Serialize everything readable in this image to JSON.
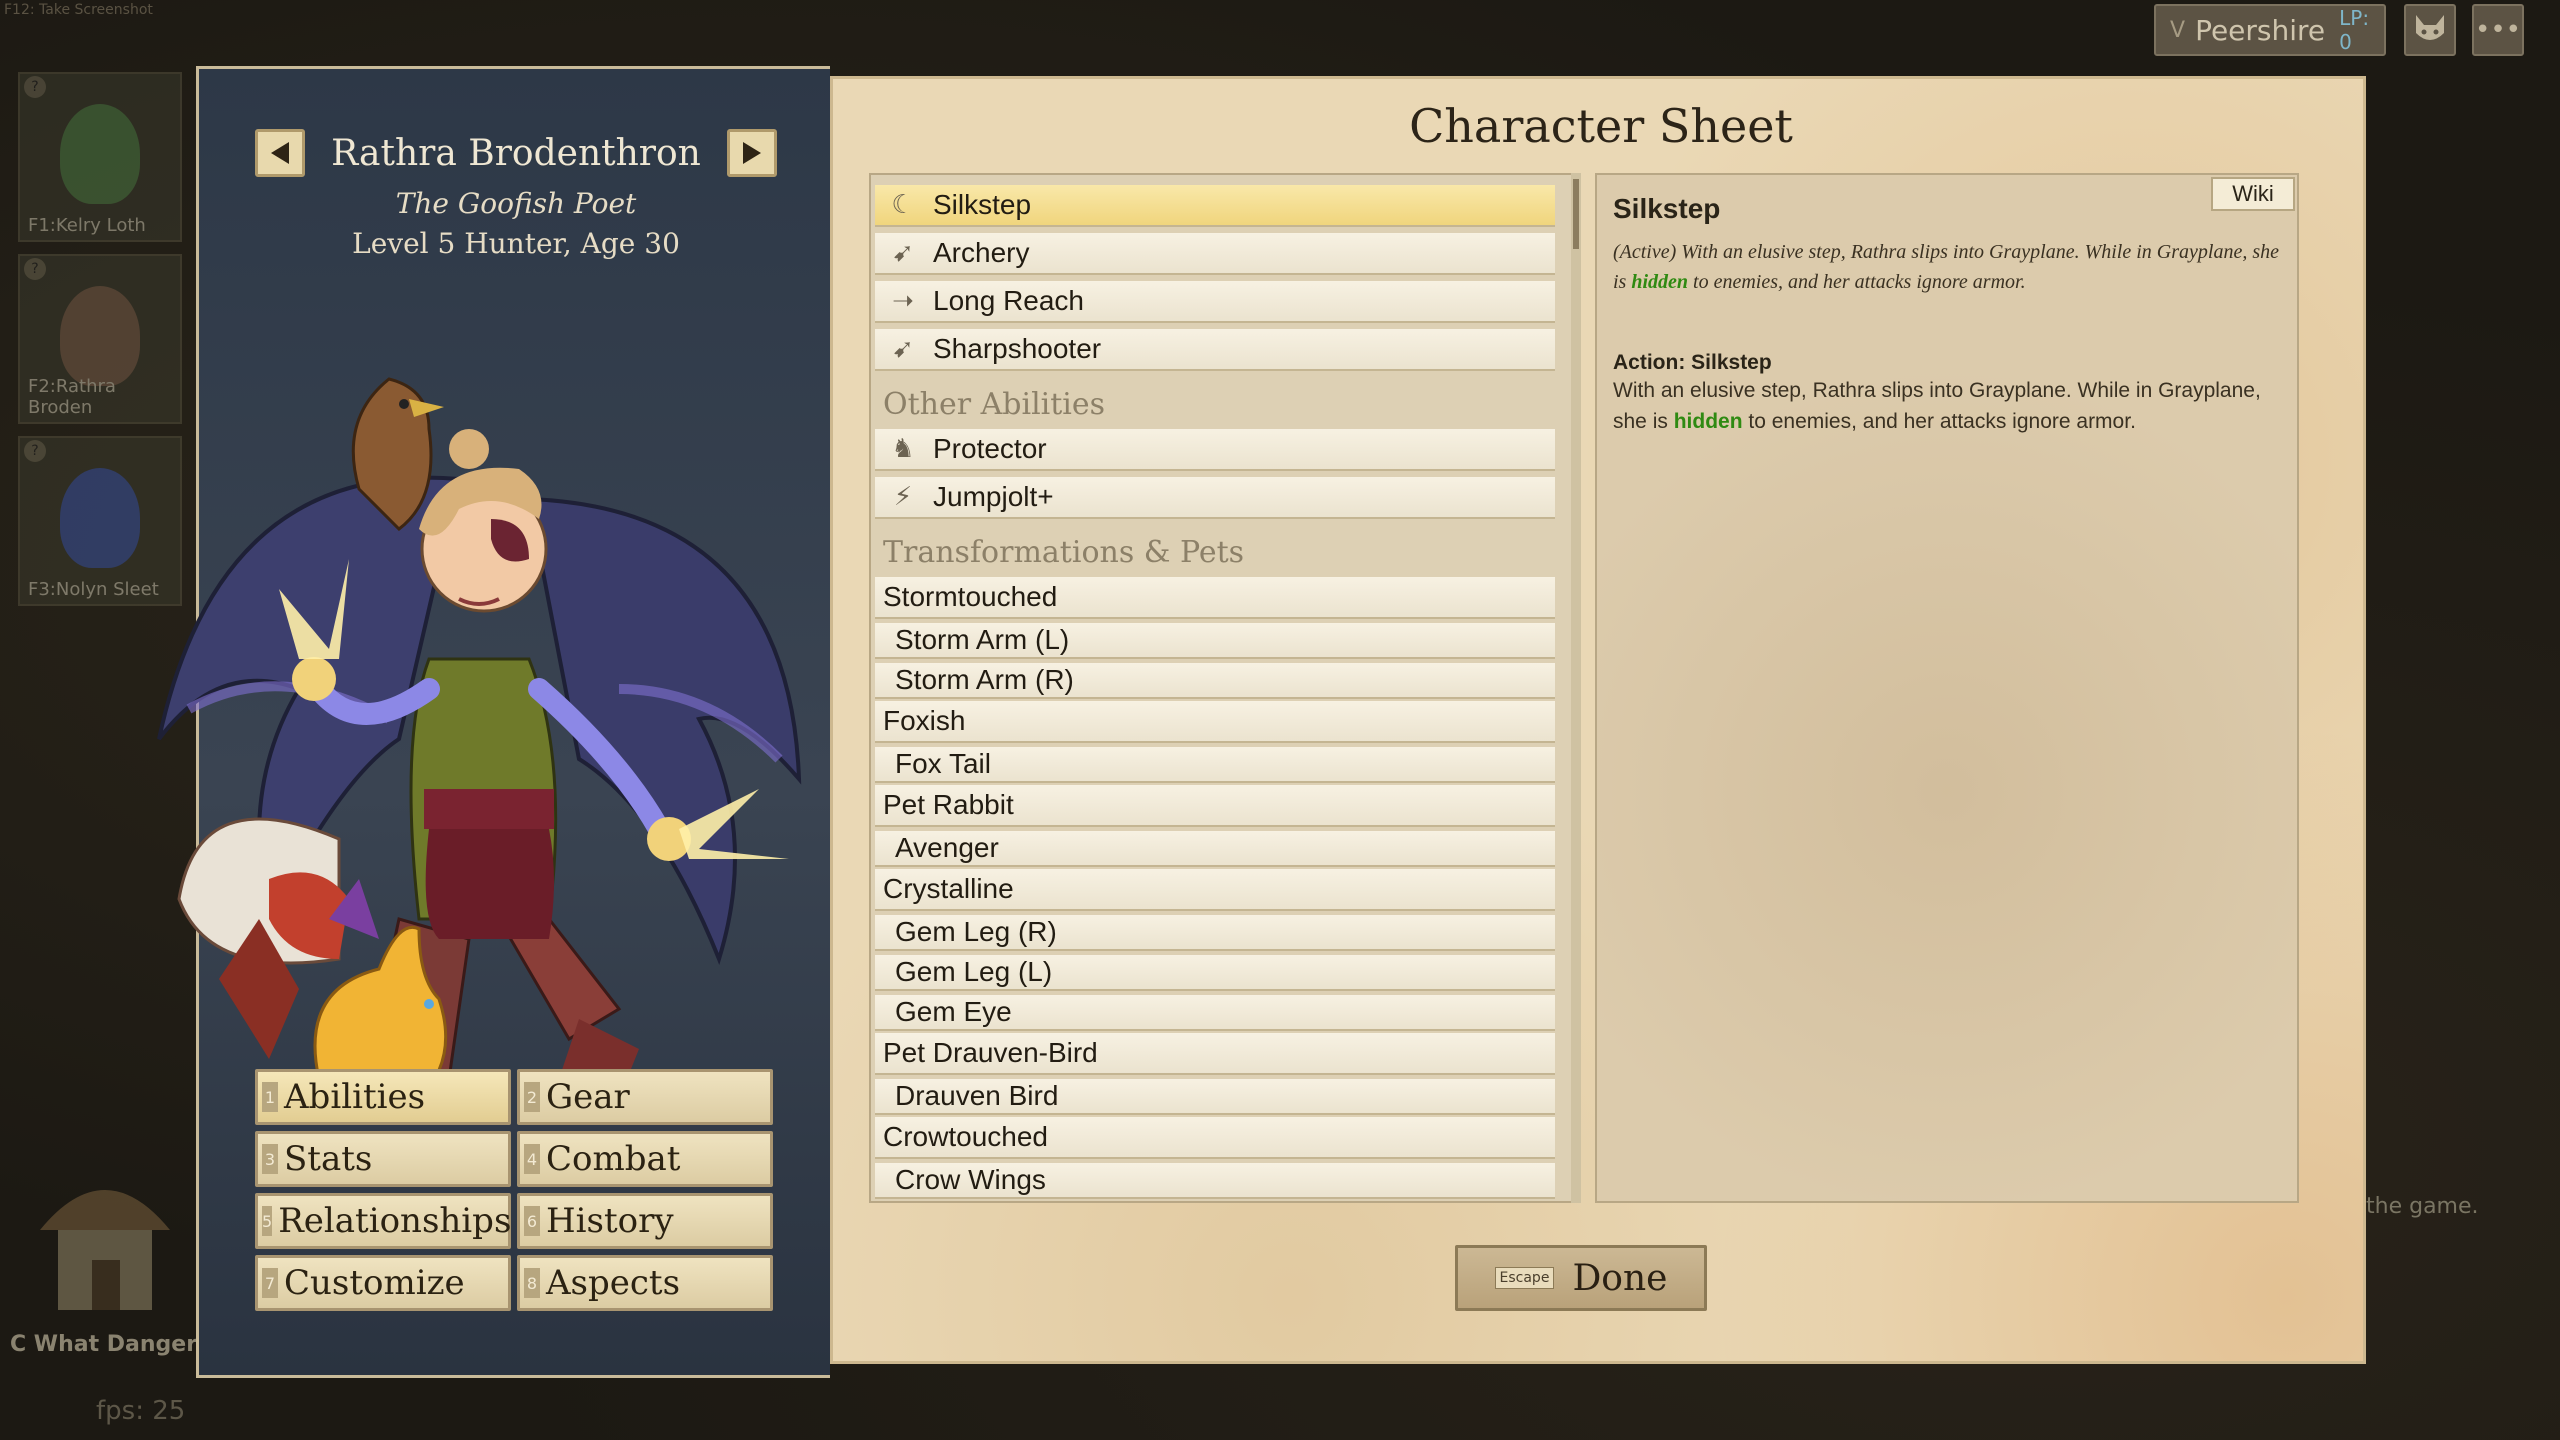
{
  "top": {
    "screenshot_hint": "F12: Take Screenshot",
    "town_key": "V",
    "town_name": "Peershire",
    "lp_label": "LP: 0"
  },
  "party": [
    {
      "label": "F1:Kelry Loth",
      "color": "#4f7d46"
    },
    {
      "label": "F2:Rathra Broden",
      "color": "#7a5e4a"
    },
    {
      "label": "F3:Nolyn Sleet",
      "color": "#3c55a2"
    }
  ],
  "bottom_quest": "C What Danger D",
  "fps": "fps: 25",
  "hint_text": "the game.",
  "character": {
    "name": "Rathra Brodenthron",
    "title": "The Goofish Poet",
    "level_line": "Level 5 Hunter, Age 30"
  },
  "nav": [
    {
      "num": "1",
      "label": "Abilities"
    },
    {
      "num": "2",
      "label": "Gear"
    },
    {
      "num": "3",
      "label": "Stats"
    },
    {
      "num": "4",
      "label": "Combat"
    },
    {
      "num": "5",
      "label": "Relationships"
    },
    {
      "num": "6",
      "label": "History"
    },
    {
      "num": "7",
      "label": "Customize"
    },
    {
      "num": "8",
      "label": "Aspects"
    }
  ],
  "sheet": {
    "title": "Character Sheet",
    "abilities": [
      "Silkstep",
      "Archery",
      "Long Reach",
      "Sharpshooter"
    ],
    "other_header": "Other Abilities",
    "other": [
      "Protector",
      "Jumpjolt+"
    ],
    "transform_header": "Transformations & Pets",
    "transforms": [
      "Stormtouched",
      "Storm Arm (L)",
      "Storm Arm (R)",
      "Foxish",
      "Fox Tail",
      "Pet Rabbit",
      "Avenger",
      "Crystalline",
      "Gem Leg (R)",
      "Gem Leg (L)",
      "Gem Eye",
      "Pet Drauven-Bird",
      "Drauven Bird",
      "Crowtouched",
      "Crow Wings"
    ]
  },
  "detail": {
    "wiki": "Wiki",
    "title": "Silkstep",
    "desc_1": "(Active) With an elusive step, Rathra slips into Grayplane. While in Grayplane, she is ",
    "hidden_word": "hidden",
    "desc_2": " to enemies, and her attacks ignore armor.",
    "action_title": "Action: Silkstep",
    "action_1": "With an elusive step, Rathra slips into Grayplane. While in Grayplane, she is ",
    "action_2": " to enemies, and her attacks ignore armor."
  },
  "done": {
    "key": "Escape",
    "label": "Done"
  }
}
